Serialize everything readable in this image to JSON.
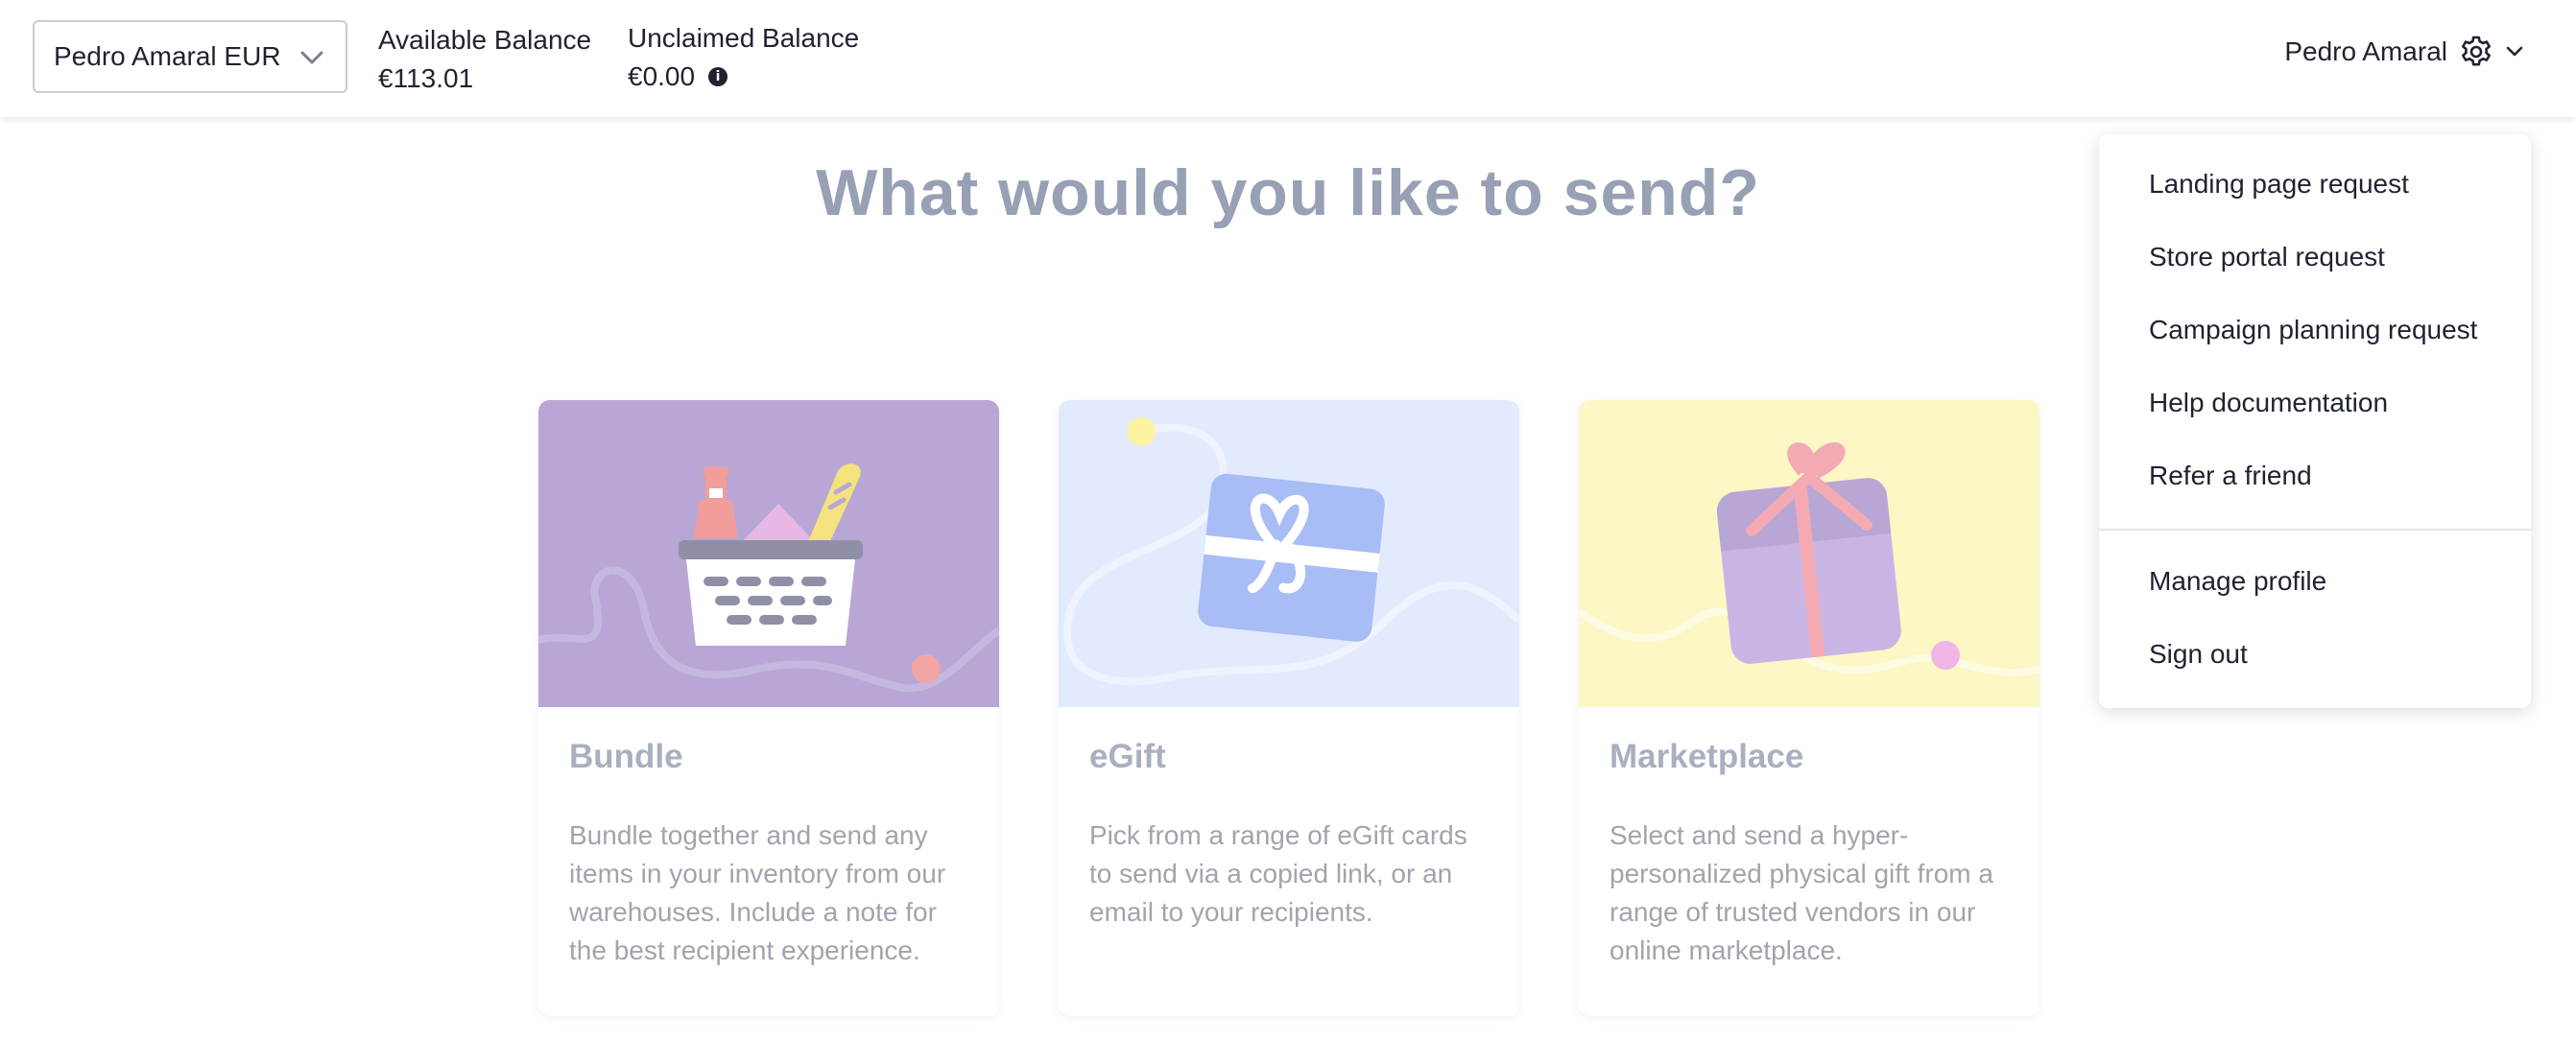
{
  "header": {
    "account_selector": "Pedro Amaral EUR",
    "available_balance_label": "Available Balance",
    "available_balance_value": "€113.01",
    "unclaimed_balance_label": "Unclaimed Balance",
    "unclaimed_balance_value": "€0.00",
    "user_name": "Pedro Amaral",
    "settings_icon": "gear-icon"
  },
  "main": {
    "title": "What would you like to send?",
    "cards": [
      {
        "title": "Bundle",
        "description": "Bundle together and send any items in your inventory from our warehouses. Include a note for the best recipient experience.",
        "bg_color": "#b8a6d5"
      },
      {
        "title": "eGift",
        "description": "Pick from a range of eGift cards to send via a copied link, or an email to your recipients.",
        "bg_color": "#e1ebfd"
      },
      {
        "title": "Marketplace",
        "description": "Select and send a hyper-personalized physical gift from a range of trusted vendors in our online marketplace.",
        "bg_color": "#fdf6c5"
      }
    ]
  },
  "menu": {
    "items": [
      "Landing page request",
      "Store portal request",
      "Campaign planning request",
      "Help documentation",
      "Refer a friend"
    ],
    "account_items": [
      "Manage profile",
      "Sign out"
    ]
  }
}
